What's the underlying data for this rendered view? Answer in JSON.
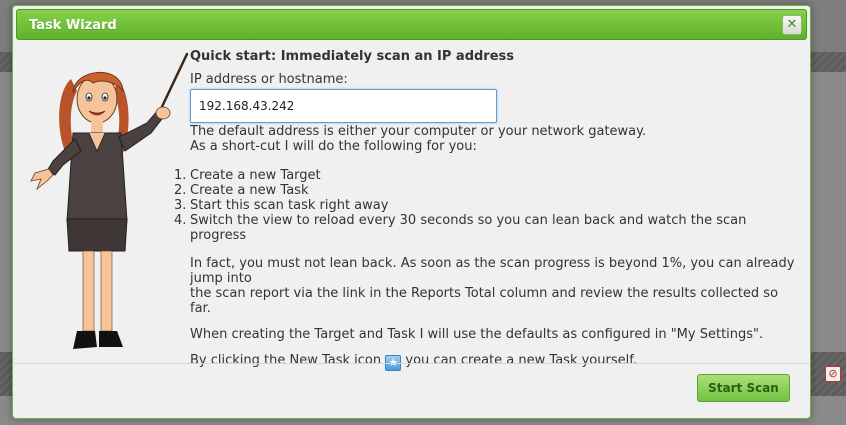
{
  "dialog": {
    "title": "Task Wizard",
    "close_label": "✕",
    "heading": "Quick start: Immediately scan an IP address",
    "ip_label": "IP address or hostname:",
    "ip_value": "192.168.43.242",
    "default_text": "The default address is either your computer or your network gateway.",
    "shortcut_text": "As a short-cut I will do the following for you:",
    "steps": [
      {
        "num": "1.",
        "text": "Create a new Target"
      },
      {
        "num": "2.",
        "text": "Create a new Task"
      },
      {
        "num": "3.",
        "text": "Start this scan task right away"
      },
      {
        "num": "4.",
        "text": "Switch the view to reload every 30 seconds so you can lean back and watch the scan progress"
      }
    ],
    "fact_text_1": "In fact, you must not lean back. As soon as the scan progress is beyond 1%, you can already jump into",
    "fact_text_2": "the scan report via the link in the Reports Total column and review the results collected so far.",
    "defaults_text": "When creating the Target and Task I will use the defaults as configured in \"My Settings\".",
    "new_task_prefix": "By clicking the New Task icon",
    "new_task_suffix": "you can create a new Task yourself.",
    "new_task_icon": "new-task-star-icon",
    "start_label": "Start Scan"
  },
  "colors": {
    "title_bar": "#5fb22a",
    "start_button": "#73c242",
    "input_border": "#5e9ed6",
    "dialog_bg": "#f0f0f0"
  }
}
